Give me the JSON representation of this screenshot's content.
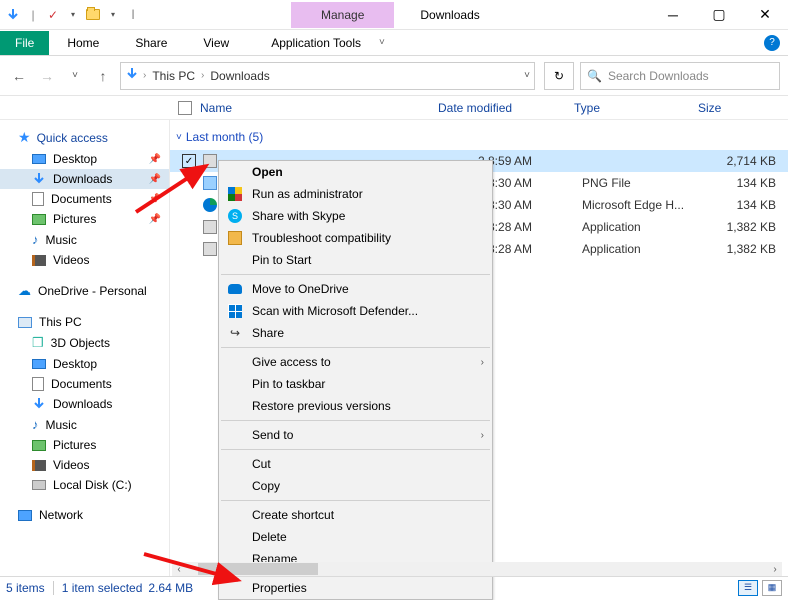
{
  "title": "Downloads",
  "ribbon_context_tab": "Manage",
  "ribbon_context_tool": "Application Tools",
  "ribbon_tabs": {
    "file": "File",
    "home": "Home",
    "share": "Share",
    "view": "View"
  },
  "breadcrumb": {
    "seg1": "This PC",
    "seg2": "Downloads"
  },
  "search_placeholder": "Search Downloads",
  "columns": {
    "name": "Name",
    "date": "Date modified",
    "type": "Type",
    "size": "Size"
  },
  "sidebar": {
    "quick_access": "Quick access",
    "desktop": "Desktop",
    "downloads": "Downloads",
    "documents": "Documents",
    "pictures": "Pictures",
    "music": "Music",
    "videos": "Videos",
    "onedrive": "OneDrive - Personal",
    "this_pc": "This PC",
    "objects3d": "3D Objects",
    "desktop2": "Desktop",
    "documents2": "Documents",
    "downloads2": "Downloads",
    "music2": "Music",
    "pictures2": "Pictures",
    "videos2": "Videos",
    "local_disk": "Local Disk (C:)",
    "network": "Network"
  },
  "group_label": "Last month (5)",
  "rows": [
    {
      "date_partial": "2 8:59 AM",
      "type": "",
      "size": "2,714 KB"
    },
    {
      "date_partial": "2 8:30 AM",
      "type": "PNG File",
      "size": "134 KB"
    },
    {
      "date_partial": "2 8:30 AM",
      "type": "Microsoft Edge H...",
      "size": "134 KB"
    },
    {
      "date_partial": "2 8:28 AM",
      "type": "Application",
      "size": "1,382 KB"
    },
    {
      "date_partial": "2 8:28 AM",
      "type": "Application",
      "size": "1,382 KB"
    }
  ],
  "context_menu": {
    "open": "Open",
    "run_admin": "Run as administrator",
    "skype": "Share with Skype",
    "troubleshoot": "Troubleshoot compatibility",
    "pin_start": "Pin to Start",
    "onedrive": "Move to OneDrive",
    "defender": "Scan with Microsoft Defender...",
    "share": "Share",
    "give_access": "Give access to",
    "pin_taskbar": "Pin to taskbar",
    "restore": "Restore previous versions",
    "send_to": "Send to",
    "cut": "Cut",
    "copy": "Copy",
    "create_shortcut": "Create shortcut",
    "delete": "Delete",
    "rename": "Rename",
    "properties": "Properties"
  },
  "status": {
    "items": "5 items",
    "selected": "1 item selected",
    "size": "2.64 MB"
  }
}
